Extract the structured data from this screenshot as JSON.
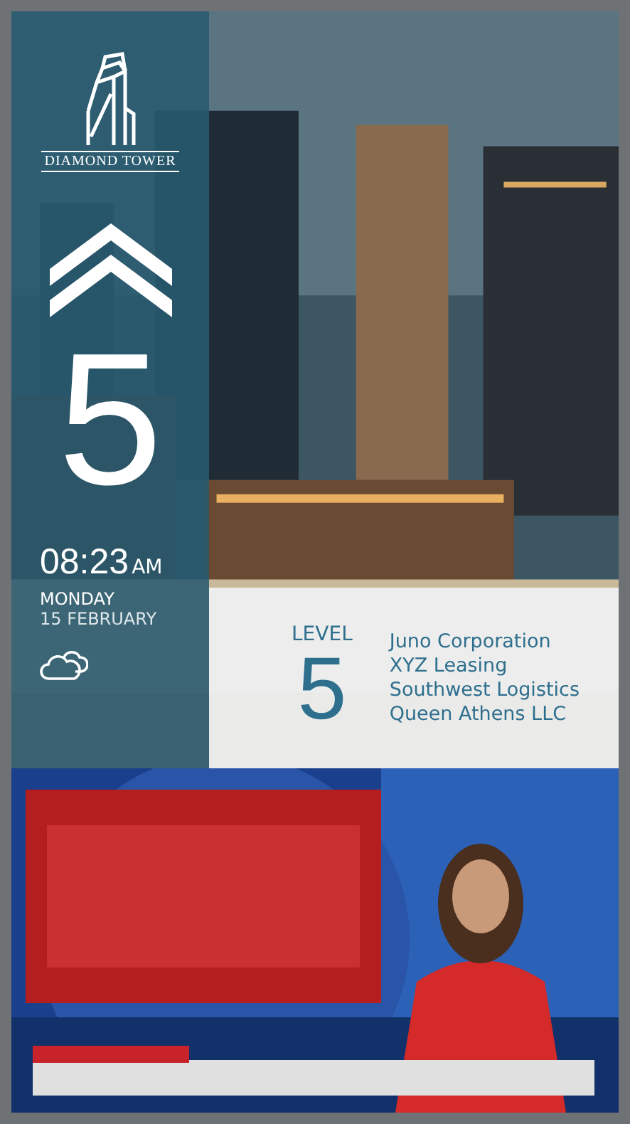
{
  "building": {
    "name": "DIAMOND TOWER",
    "floor": "5"
  },
  "clock": {
    "time": "08:23",
    "meridiem": "AM",
    "day": "MONDAY",
    "date": "15 FEBRUARY"
  },
  "directory": {
    "label": "LEVEL",
    "level": "5",
    "tenants": [
      "Juno Corporation",
      "XYZ Leasing",
      "Southwest Logistics",
      "Queen Athens LLC"
    ]
  }
}
